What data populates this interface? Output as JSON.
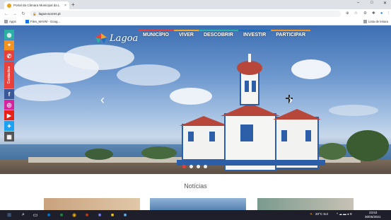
{
  "browser": {
    "tab_title": "Portal da Câmara Municipal da L",
    "tab_close": "×",
    "new_tab": "+",
    "window_controls": [
      "–",
      "□",
      "✕"
    ],
    "url": "lagoa-acores.pt",
    "bookmarks": [
      {
        "label": "Apps",
        "icon": "apps-grid-icon"
      },
      {
        "label": "Files_MAVM - Goog...",
        "icon": "google-drive-icon"
      }
    ],
    "reading_list": "Lista de leitura"
  },
  "site": {
    "logo_text": "Lagoa",
    "nav": [
      {
        "label": "MUNICÍPIO",
        "color": "#e8413c"
      },
      {
        "label": "VIVER",
        "color": "#f5a623"
      },
      {
        "label": "DESCOBRIR",
        "color": "#2bb0a3"
      },
      {
        "label": "INVESTIR",
        "color": "#1f6fc1"
      },
      {
        "label": "PARTICIPAR",
        "color": "#f29221"
      }
    ],
    "sidebar_contactos": "Contactos",
    "sidebar_icons": [
      "globe-icon",
      "location-pin-icon",
      "phone-icon",
      "facebook-icon",
      "instagram-icon",
      "youtube-icon",
      "twitter-icon",
      "gallery-icon"
    ],
    "carousel": {
      "slides": 4,
      "active": 1,
      "prev": "‹",
      "next": "›"
    },
    "news_heading": "Notícias"
  },
  "taskbar": {
    "weather": "20°C Sol",
    "time": "23:53",
    "date": "30/05/2021"
  }
}
